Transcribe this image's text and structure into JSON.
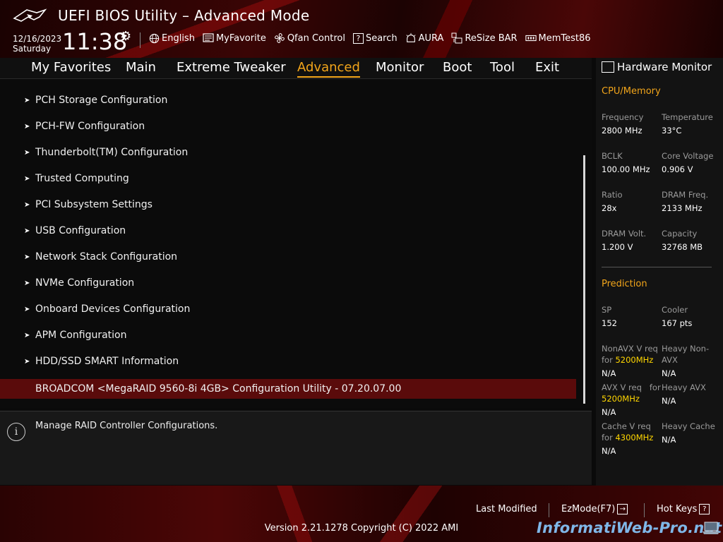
{
  "header": {
    "title": "UEFI BIOS Utility – Advanced Mode",
    "date": "12/16/2023",
    "day": "Saturday",
    "time": "11:38",
    "toolbar": [
      {
        "label": "English",
        "icon": "globe-icon"
      },
      {
        "label": "MyFavorite",
        "icon": "favorite-icon"
      },
      {
        "label": "Qfan Control",
        "icon": "fan-icon"
      },
      {
        "label": "Search",
        "icon": "search-help-icon"
      },
      {
        "label": "AURA",
        "icon": "aura-icon"
      },
      {
        "label": "ReSize BAR",
        "icon": "resize-bar-icon"
      },
      {
        "label": "MemTest86",
        "icon": "memtest-icon"
      }
    ]
  },
  "tabs": [
    "My Favorites",
    "Main",
    "Extreme Tweaker",
    "Advanced",
    "Monitor",
    "Boot",
    "Tool",
    "Exit"
  ],
  "active_tab": "Advanced",
  "menu": {
    "items": [
      "PCH Storage Configuration",
      "PCH-FW Configuration",
      "Thunderbolt(TM) Configuration",
      "Trusted Computing",
      "PCI Subsystem Settings",
      "USB Configuration",
      "Network Stack Configuration",
      "NVMe Configuration",
      "Onboard Devices Configuration",
      "APM Configuration",
      "HDD/SSD SMART Information"
    ],
    "selected": "BROADCOM <MegaRAID 9560-8i 4GB> Configuration Utility - 07.20.07.00"
  },
  "help": {
    "text": "Manage RAID Controller Configurations."
  },
  "hardware_monitor": {
    "title": "Hardware Monitor",
    "cpu_memory": {
      "section": "CPU/Memory",
      "frequency_label": "Frequency",
      "frequency": "2800 MHz",
      "temperature_label": "Temperature",
      "temperature": "33°C",
      "bclk_label": "BCLK",
      "bclk": "100.00 MHz",
      "core_voltage_label": "Core Voltage",
      "core_voltage": "0.906 V",
      "ratio_label": "Ratio",
      "ratio": "28x",
      "dram_freq_label": "DRAM Freq.",
      "dram_freq": "2133 MHz",
      "dram_volt_label": "DRAM Volt.",
      "dram_volt": "1.200 V",
      "capacity_label": "Capacity",
      "capacity": "32768 MB"
    },
    "prediction": {
      "section": "Prediction",
      "sp_label": "SP",
      "sp": "152",
      "cooler_label": "Cooler",
      "cooler": "167 pts",
      "nonavx_label_1": "NonAVX V req",
      "nonavx_label_for": "for",
      "nonavx_freq": "5200MHz",
      "nonavx_value": "N/A",
      "heavy_nonavx_label": "Heavy Non-AVX",
      "heavy_nonavx_value": "N/A",
      "avx_label_1": "AVX V req",
      "avx_label_for": "for",
      "avx_freq": "5200MHz",
      "avx_value": "N/A",
      "heavy_avx_label": "Heavy AVX",
      "heavy_avx_value": "N/A",
      "cache_label_1": "Cache V req",
      "cache_label_for": "for",
      "cache_freq": "4300MHz",
      "cache_value": "N/A",
      "heavy_cache_label": "Heavy Cache",
      "heavy_cache_value": "N/A"
    }
  },
  "footer": {
    "last_modified": "Last Modified",
    "ezmode": "EzMode(F7)",
    "hotkeys": "Hot Keys",
    "version": "Version 2.21.1278 Copyright (C) 2022 AMI"
  },
  "watermark": "InformatiWeb-Pro.net",
  "colors": {
    "accent": "#f2a51a",
    "selected_row": "#5a0b0b",
    "highlight": "#ffd600"
  }
}
